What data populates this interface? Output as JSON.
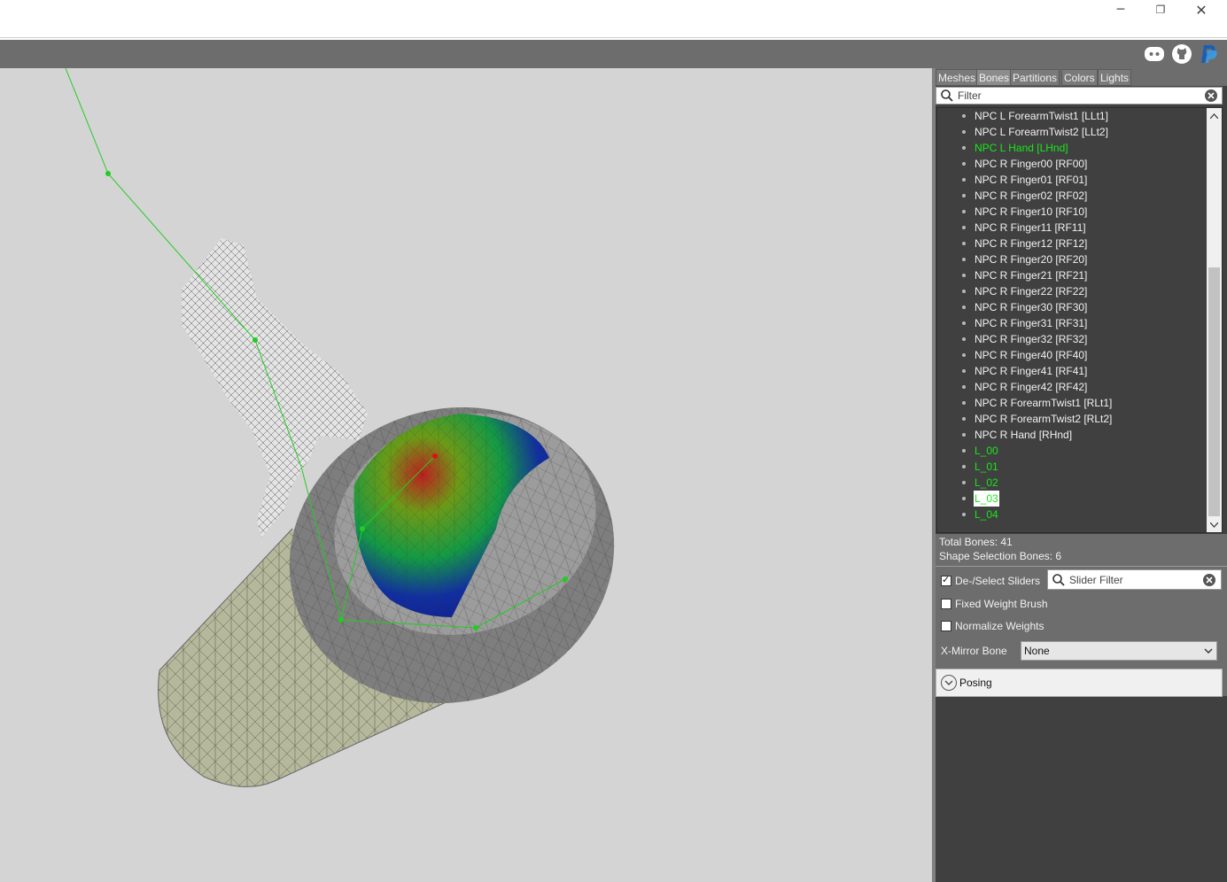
{
  "window": {
    "minimize_glyph": "─",
    "restore_glyph": "❐",
    "close_glyph": "✕"
  },
  "toolbar": {
    "icons": [
      "discord-icon",
      "github-icon",
      "paypal-icon"
    ]
  },
  "tabs": [
    {
      "label": "Meshes",
      "active": false
    },
    {
      "label": "Bones",
      "active": true
    },
    {
      "label": "Partitions",
      "active": false
    },
    {
      "label": "Colors",
      "active": false
    },
    {
      "label": "Lights",
      "active": false
    }
  ],
  "filter": {
    "placeholder": "Filter"
  },
  "bones": [
    {
      "label": "NPC L ForearmTwist1 [LLt1]",
      "state": "normal"
    },
    {
      "label": "NPC L ForearmTwist2 [LLt2]",
      "state": "normal"
    },
    {
      "label": "NPC L Hand [LHnd]",
      "state": "green"
    },
    {
      "label": "NPC R Finger00 [RF00]",
      "state": "normal"
    },
    {
      "label": "NPC R Finger01 [RF01]",
      "state": "normal"
    },
    {
      "label": "NPC R Finger02 [RF02]",
      "state": "normal"
    },
    {
      "label": "NPC R Finger10 [RF10]",
      "state": "normal"
    },
    {
      "label": "NPC R Finger11 [RF11]",
      "state": "normal"
    },
    {
      "label": "NPC R Finger12 [RF12]",
      "state": "normal"
    },
    {
      "label": "NPC R Finger20 [RF20]",
      "state": "normal"
    },
    {
      "label": "NPC R Finger21 [RF21]",
      "state": "normal"
    },
    {
      "label": "NPC R Finger22 [RF22]",
      "state": "normal"
    },
    {
      "label": "NPC R Finger30 [RF30]",
      "state": "normal"
    },
    {
      "label": "NPC R Finger31 [RF31]",
      "state": "normal"
    },
    {
      "label": "NPC R Finger32 [RF32]",
      "state": "normal"
    },
    {
      "label": "NPC R Finger40 [RF40]",
      "state": "normal"
    },
    {
      "label": "NPC R Finger41 [RF41]",
      "state": "normal"
    },
    {
      "label": "NPC R Finger42 [RF42]",
      "state": "normal"
    },
    {
      "label": "NPC R ForearmTwist1 [RLt1]",
      "state": "normal"
    },
    {
      "label": "NPC R ForearmTwist2 [RLt2]",
      "state": "normal"
    },
    {
      "label": "NPC R Hand [RHnd]",
      "state": "normal"
    },
    {
      "label": "L_00",
      "state": "green"
    },
    {
      "label": "L_01",
      "state": "green"
    },
    {
      "label": "L_02",
      "state": "green"
    },
    {
      "label": "L_03",
      "state": "selected"
    },
    {
      "label": "L_04",
      "state": "green"
    }
  ],
  "stats": {
    "total_bones": "Total Bones: 41",
    "shape_selection_bones": "Shape Selection Bones: 6"
  },
  "controls": {
    "deselect_sliders": {
      "label": "De-/Select Sliders",
      "checked": true
    },
    "slider_filter_placeholder": "Slider Filter",
    "fixed_weight_brush": {
      "label": "Fixed Weight Brush",
      "checked": false
    },
    "normalize_weights": {
      "label": "Normalize Weights",
      "checked": false
    },
    "xmirror_label": "X-Mirror Bone",
    "xmirror_value": "None",
    "posing_label": "Posing"
  },
  "colors": {
    "viewport_bg": "#d4d4d4",
    "panel_bg": "#404040",
    "bone_highlight": "#17e817",
    "bone_line": "#22cc22"
  }
}
